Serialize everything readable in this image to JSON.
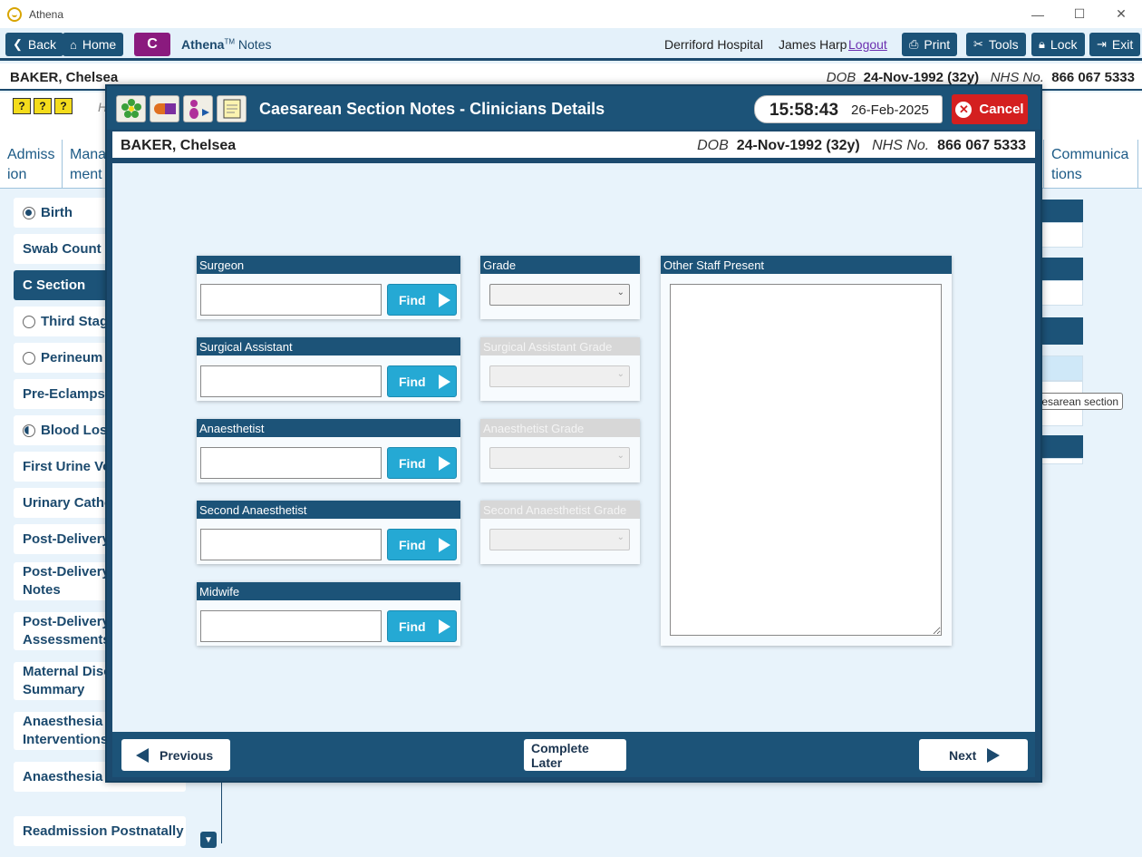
{
  "window": {
    "app_name": "Athena",
    "controls": [
      "—",
      "☐",
      "✕"
    ]
  },
  "nav": {
    "back": "Back",
    "home": "Home",
    "badge": "C",
    "brand_name": "Athena",
    "brand_tm": "TM",
    "brand_suffix": "Notes",
    "hospital": "Derriford Hospital",
    "user": "James Harp",
    "logout": "Logout",
    "print": "Print",
    "tools": "Tools",
    "lock": "Lock",
    "exit": "Exit"
  },
  "patient": {
    "name": "BAKER, Chelsea",
    "dob_label": "DOB",
    "dob_value": "24-Nov-1992 (32y)",
    "nhs_label": "NHS No.",
    "nhs_value": "866 067 5333"
  },
  "background": {
    "help_icons": [
      "?",
      "?",
      "?"
    ],
    "h_text": "H",
    "tabs": [
      {
        "label": "Admiss\nion"
      },
      {
        "label": "Mana\nment"
      },
      {
        "label": "Communica\ntions"
      }
    ],
    "tooltip": "Caesarean section"
  },
  "sidebar": {
    "items": [
      {
        "label": "Birth",
        "marker": "filled"
      },
      {
        "label": "Swab Count",
        "marker": "none"
      },
      {
        "label": "C Section",
        "marker": "none",
        "active": true
      },
      {
        "label": "Third Stage",
        "marker": "empty"
      },
      {
        "label": "Perineum",
        "marker": "empty"
      },
      {
        "label": "Pre-Eclampsia",
        "marker": "none"
      },
      {
        "label": "Blood Loss",
        "marker": "half"
      },
      {
        "label": "First Urine Voi",
        "marker": "none"
      },
      {
        "label": "Urinary Cathe",
        "marker": "none"
      },
      {
        "label": "Post-Delivery",
        "marker": "none"
      },
      {
        "label": "Post-Delivery\nNotes",
        "marker": "none"
      },
      {
        "label": "Post-Delivery\nAssessments",
        "marker": "none"
      },
      {
        "label": "Maternal Disc\nSummary",
        "marker": "none"
      },
      {
        "label": "Anaesthesia\nInterventions",
        "marker": "none"
      },
      {
        "label": "Anaesthesia F",
        "marker": "none"
      },
      {
        "label": "Readmission Postnatally",
        "marker": "none"
      }
    ]
  },
  "modal": {
    "title": "Caesarean Section Notes - Clinicians Details",
    "time": "15:58:43",
    "date": "26-Feb-2025",
    "cancel": "Cancel",
    "staff_fields": [
      {
        "label": "Surgeon",
        "value": "",
        "find": "Find"
      },
      {
        "label": "Surgical Assistant",
        "value": "",
        "find": "Find"
      },
      {
        "label": "Anaesthetist",
        "value": "",
        "find": "Find"
      },
      {
        "label": "Second Anaesthetist",
        "value": "",
        "find": "Find"
      },
      {
        "label": "Midwife",
        "value": "",
        "find": "Find"
      }
    ],
    "grade_fields": [
      {
        "label": "Grade",
        "value": "",
        "enabled": true
      },
      {
        "label": "Surgical Assistant Grade",
        "value": "",
        "enabled": false
      },
      {
        "label": "Anaesthetist Grade",
        "value": "",
        "enabled": false
      },
      {
        "label": "Second Anaesthetist Grade",
        "value": "",
        "enabled": false
      }
    ],
    "other_staff": {
      "label": "Other Staff Present",
      "value": ""
    },
    "footer": {
      "previous": "Previous",
      "complete_later": "Complete Later",
      "next": "Next"
    }
  },
  "colors": {
    "primary_dark": "#1c5378",
    "accent_find": "#25a9d4",
    "cancel_red": "#d41f1f",
    "badge_purple": "#8a1a7e",
    "logout_link": "#6b2fb0",
    "page_bg": "#e8f3fb"
  }
}
